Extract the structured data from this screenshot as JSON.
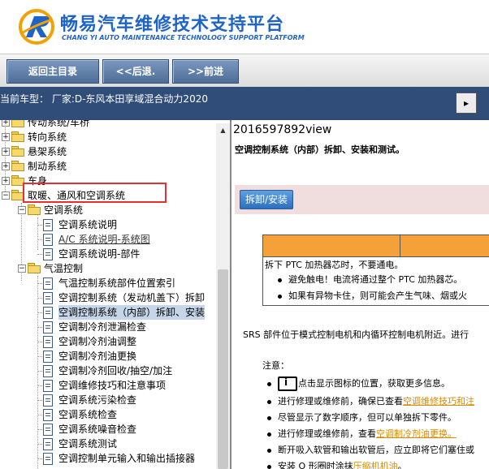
{
  "header": {
    "title": "畅易汽车维修技术支持平台",
    "subtitle": "CHANG YI AUTO MAINTENANCE TECHNOLOGY SUPPORT PLATFORM"
  },
  "nav": {
    "home": "返回主目录",
    "back": "<<后退.",
    "forward": ">>前进"
  },
  "model": {
    "text": "当前车型： 厂家:D-东风本田享域混合动力2020",
    "toggle": "▸"
  },
  "tree": {
    "items": [
      {
        "label": "传动系统/车桥"
      },
      {
        "label": "转向系统"
      },
      {
        "label": "悬架系统"
      },
      {
        "label": "制动系统"
      },
      {
        "label": "车身"
      },
      {
        "label": "取暖、通风和空调系统"
      },
      {
        "label": "空调系统"
      },
      {
        "label": "空调系统说明"
      },
      {
        "label": "A/C 系统说明-系统图"
      },
      {
        "label": "空调系统说明-部件"
      },
      {
        "label": "气温控制"
      },
      {
        "label": "气温控制系统部件位置索引"
      },
      {
        "label": "空调控制系统（发动机盖下）拆卸"
      },
      {
        "label": "空调控制系统（内部）拆卸、安装"
      },
      {
        "label": "空调制冷剂泄漏检查"
      },
      {
        "label": "空调制冷剂油调整"
      },
      {
        "label": "空调制冷剂油更换"
      },
      {
        "label": "空调制冷剂回收/抽空/加注"
      },
      {
        "label": "空调维修技巧和注意事项"
      },
      {
        "label": "空调系统污染检查"
      },
      {
        "label": "空调系统检查"
      },
      {
        "label": "空调系统噪音检查"
      },
      {
        "label": "空调系统测试"
      },
      {
        "label": "空调控制单元输入和输出插接器"
      }
    ]
  },
  "content": {
    "doc_id": "2016597892view",
    "title": "空调控制系统（内部）拆卸、安装和测试。",
    "section_button": "拆卸/安装",
    "ptc_warning": "拆下 PTC 加热器芯时，不要通电。",
    "ptc_bullets": [
      "避免触电！电流将通过整个 PTC 加热器芯。",
      "如果有异物卡住，则可能会产生气味、烟或火"
    ],
    "srs_text": "SRS 部件位于模式控制电机和内循环控制电机附近。进行",
    "note_label": "注意：",
    "notes": [
      {
        "pre": "点击显示图标的位置，获取更多信息。",
        "link": "",
        "post": ""
      },
      {
        "pre": "进行修理或维修前，确保已查看",
        "link": "空调维修技巧和注",
        "post": ""
      },
      {
        "pre": "尽管显示了数字顺序，但可以单独拆下零件。",
        "link": "",
        "post": ""
      },
      {
        "pre": "进行修理或维修前，查看",
        "link": "空调制冷剂油更换。",
        "post": ""
      },
      {
        "pre": "断开吸入软管和输出软管后，应立即将它们塞住或",
        "link": "",
        "post": ""
      },
      {
        "pre": "安装 O 形圈时涂抹",
        "link": "压缩机机油",
        "post": "。"
      }
    ]
  },
  "colors": {
    "brand": "#1e63c8",
    "model_bar": "#2f4d78",
    "highlight": "#e43030",
    "ptc_header": "#f5a13a",
    "link": "#d98a00"
  }
}
